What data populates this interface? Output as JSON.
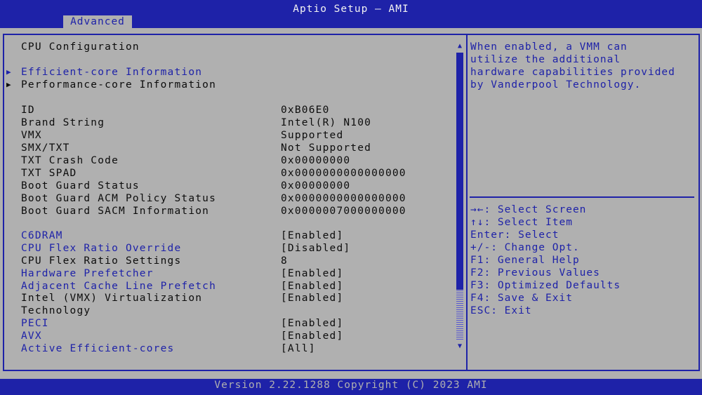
{
  "header": {
    "title": "Aptio Setup – AMI",
    "active_tab": "Advanced"
  },
  "section_title": "CPU Configuration",
  "submenus": [
    {
      "label": "Efficient-core Information"
    },
    {
      "label": "Performance-core Information"
    }
  ],
  "info": [
    {
      "label": "ID",
      "value": "0xB06E0"
    },
    {
      "label": "Brand String",
      "value": "Intel(R) N100"
    },
    {
      "label": "VMX",
      "value": "Supported"
    },
    {
      "label": "SMX/TXT",
      "value": "Not Supported"
    },
    {
      "label": "TXT Crash Code",
      "value": "0x00000000"
    },
    {
      "label": "TXT SPAD",
      "value": "0x0000000000000000"
    },
    {
      "label": "Boot Guard Status",
      "value": "0x00000000"
    },
    {
      "label": "Boot Guard ACM Policy Status",
      "value": "0x0000000000000000"
    },
    {
      "label": "Boot Guard SACM Information",
      "value": "0x0000007000000000"
    }
  ],
  "settings": [
    {
      "label": "C6DRAM",
      "value": "[Enabled]"
    },
    {
      "label": "CPU Flex Ratio Override",
      "value": "[Disabled]"
    },
    {
      "label": "CPU Flex Ratio Settings",
      "value": "8"
    },
    {
      "label": "Hardware Prefetcher",
      "value": "[Enabled]"
    },
    {
      "label": "Adjacent Cache Line Prefetch",
      "value": "[Enabled]"
    },
    {
      "label": "Intel (VMX) Virtualization",
      "label2": "Technology",
      "value": "[Enabled]"
    },
    {
      "label": "PECI",
      "value": "[Enabled]"
    },
    {
      "label": "AVX",
      "value": "[Enabled]"
    },
    {
      "label": "Active Efficient-cores",
      "value": "[All]"
    }
  ],
  "help": {
    "lines": [
      "When enabled, a VMM can",
      "utilize the additional",
      "hardware capabilities provided",
      "by Vanderpool Technology."
    ]
  },
  "keys": [
    "→←: Select Screen",
    "↑↓: Select Item",
    "Enter: Select",
    "+/-: Change Opt.",
    "F1: General Help",
    "F2: Previous Values",
    "F3: Optimized Defaults",
    "F4: Save & Exit",
    "ESC: Exit"
  ],
  "footer": {
    "text": "Version 2.22.1288 Copyright (C) 2023 AMI"
  },
  "colors": {
    "accent": "#1e22a8",
    "background": "#b0b0b0",
    "text": "#0c0c0c"
  },
  "icons": {
    "submenu": "triangle-right-icon",
    "scroll_up": "triangle-up-icon",
    "scroll_down": "triangle-down-icon"
  }
}
